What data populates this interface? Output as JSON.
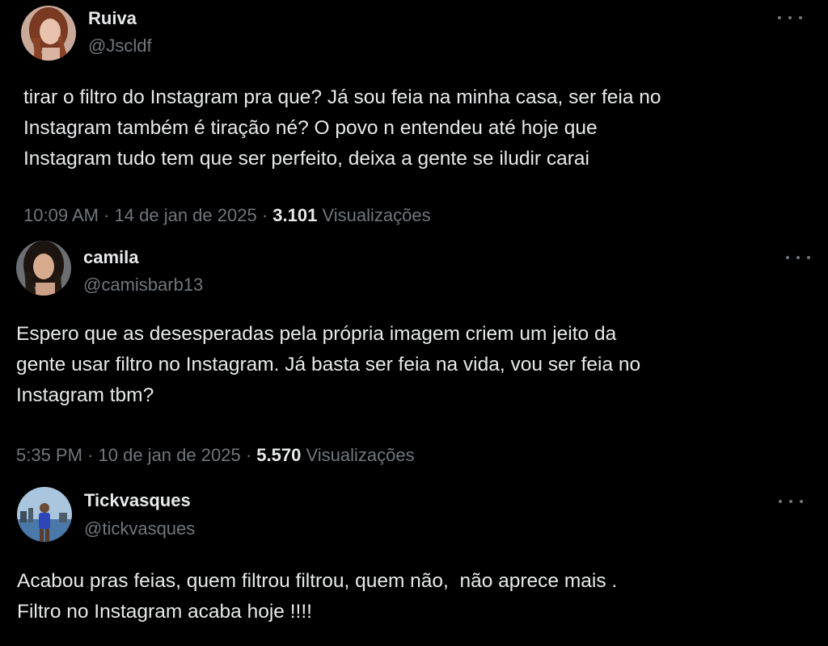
{
  "tweets": [
    {
      "display_name": "Ruiva",
      "handle": "@Jscldf",
      "avatar_icon": "profile-photo-woman-red-hair",
      "more_icon": "more-options-icon",
      "text_lines": [
        "tirar o filtro do Instagram pra que? Já sou feia na minha casa, ser feia no",
        "Instagram também é tiração né? O povo n entendeu até hoje que",
        "Instagram tudo tem que ser perfeito, deixa a gente se iludir carai"
      ],
      "time": "10:09 AM",
      "date": "14 de jan de 2025",
      "views_count": "3.101",
      "views_label": "Visualizações"
    },
    {
      "display_name": "camila",
      "handle": "@camisbarb13",
      "avatar_icon": "profile-photo-woman-dark-hair",
      "more_icon": "more-options-icon",
      "text_lines": [
        "Espero que as desesperadas pela própria imagem criem um jeito da",
        "gente usar filtro no Instagram. Já basta ser feia na vida, vou ser feia no",
        "Instagram tbm?"
      ],
      "time": "5:35 PM",
      "date": "10 de jan de 2025",
      "views_count": "5.570",
      "views_label": "Visualizações"
    },
    {
      "display_name": "Tickvasques",
      "handle": "@tickvasques",
      "avatar_icon": "profile-photo-man-outdoors",
      "more_icon": "more-options-icon",
      "text_lines": [
        "Acabou pras feias, quem filtrou filtrou, quem não,  não aprece mais .",
        "Filtro no Instagram acaba hoje !!!!"
      ]
    }
  ],
  "separator": "·",
  "colors": {
    "background": "#000000",
    "primary_text": "#e7e9ea",
    "secondary_text": "#71767b"
  }
}
